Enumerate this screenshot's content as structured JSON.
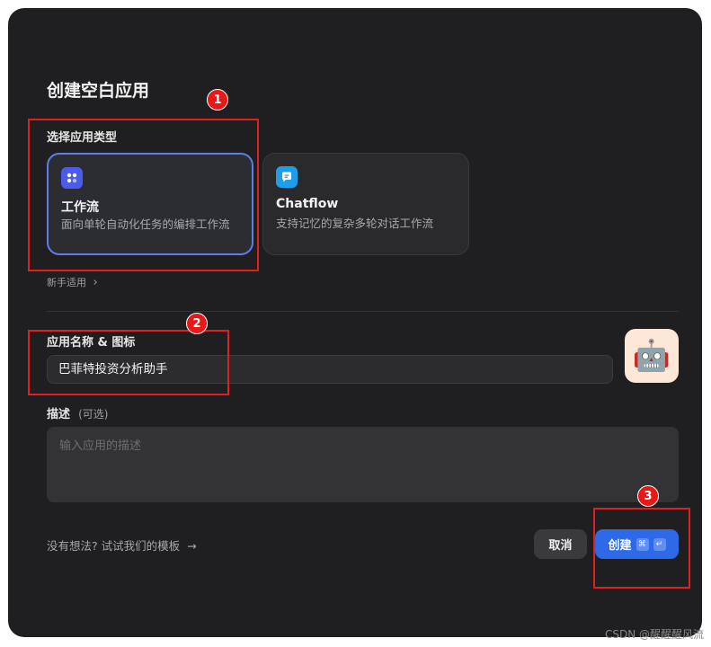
{
  "dialog": {
    "title": "创建空白应用",
    "type_section": {
      "label": "选择应用类型",
      "cards": [
        {
          "title": "工作流",
          "desc": "面向单轮自动化任务的编排工作流",
          "icon": "workflow-icon",
          "icon_color": "#4b5bea",
          "selected": true
        },
        {
          "title": "Chatflow",
          "desc": "支持记忆的复杂多轮对话工作流",
          "icon": "chat-icon",
          "icon_color": "#1e9de8",
          "selected": false
        }
      ],
      "newbie_link": "新手适用",
      "newbie_chevron": "›"
    },
    "name_section": {
      "label": "应用名称 & 图标",
      "value": "巴菲特投资分析助手",
      "avatar": "🤖"
    },
    "desc_section": {
      "label": "描述",
      "optional": "(可选)",
      "placeholder": "输入应用的描述"
    },
    "footer": {
      "template_link": "没有想法? 试试我们的模板",
      "template_arrow": "→",
      "cancel_label": "取消",
      "create_label": "创建",
      "create_kbd_1": "⌘",
      "create_kbd_2": "↵"
    }
  },
  "annotations": {
    "badge_1": "1",
    "badge_2": "2",
    "badge_3": "3",
    "color": "#e02020"
  },
  "watermark": "CSDN @醒醒醒风流"
}
